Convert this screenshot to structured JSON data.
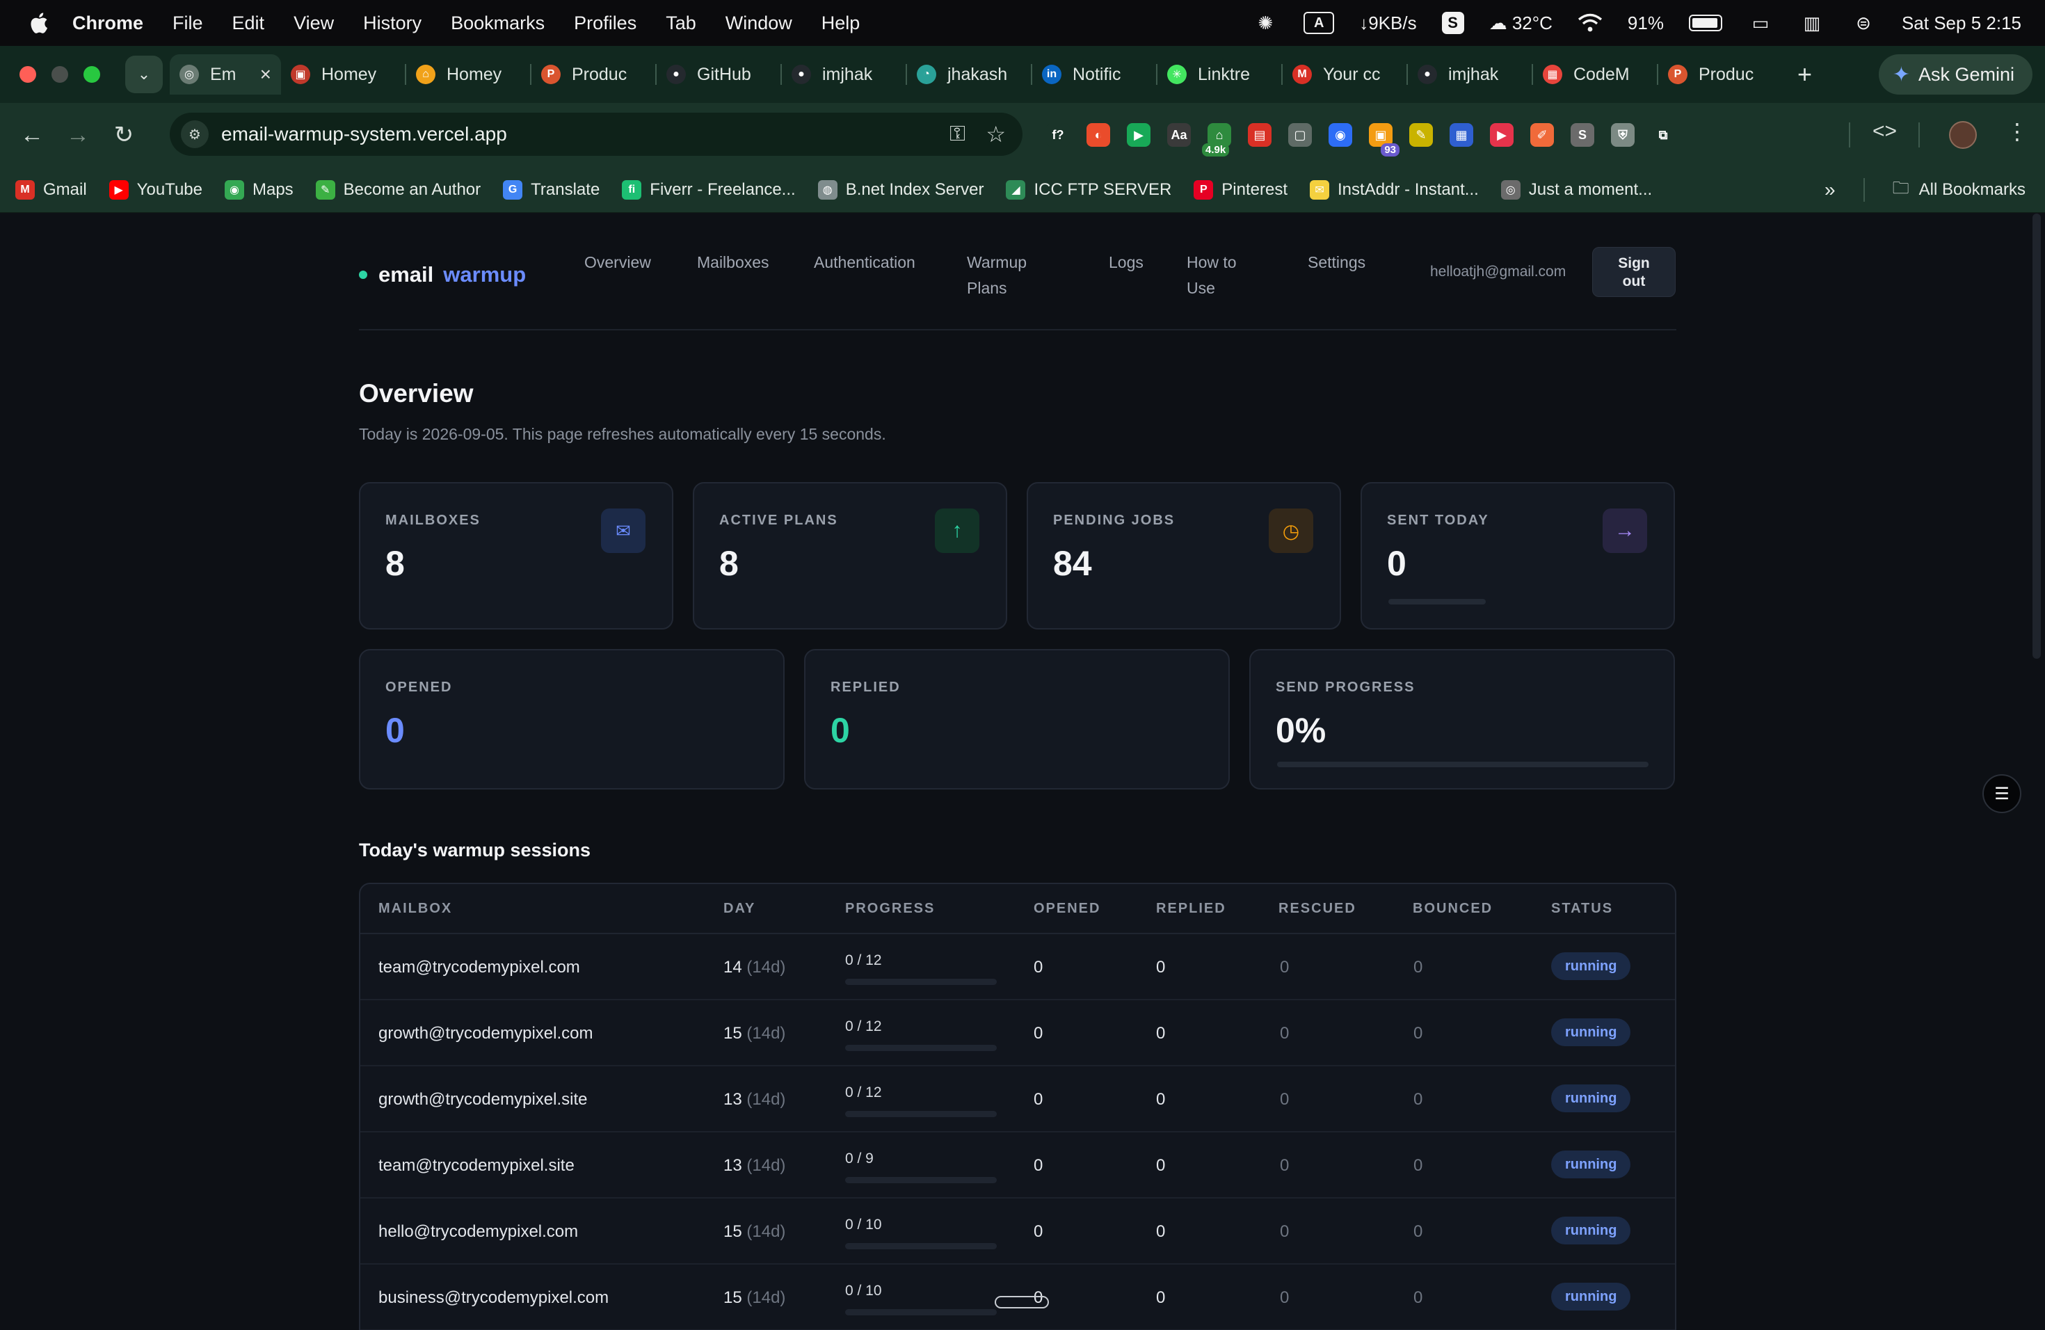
{
  "menubar": {
    "app": "Chrome",
    "items": [
      "File",
      "Edit",
      "View",
      "History",
      "Bookmarks",
      "Profiles",
      "Tab",
      "Window",
      "Help"
    ],
    "net_speed": "↓9KB/s",
    "weather": "32°C",
    "battery": "91%",
    "datetime": "Sat Sep 5  2:15"
  },
  "tabs": [
    {
      "label": "Em",
      "color": "#6b7c74",
      "glyph": "◎",
      "active": true
    },
    {
      "label": "Homey",
      "color": "#c0392b",
      "glyph": "▣"
    },
    {
      "label": "Homey",
      "color": "#f1a21a",
      "glyph": "⌂"
    },
    {
      "label": "Produc",
      "color": "#da552f",
      "glyph": "P"
    },
    {
      "label": "GitHub",
      "color": "#24292e",
      "glyph": "●"
    },
    {
      "label": "imjhak",
      "color": "#24292e",
      "glyph": "●"
    },
    {
      "label": "jhakash",
      "color": "#2aa198",
      "glyph": "◔"
    },
    {
      "label": "Notific",
      "color": "#0a66c2",
      "glyph": "in"
    },
    {
      "label": "Linktre",
      "color": "#43e660",
      "glyph": "✳"
    },
    {
      "label": "Your cc",
      "color": "#d93025",
      "glyph": "M"
    },
    {
      "label": "imjhak",
      "color": "#24292e",
      "glyph": "●"
    },
    {
      "label": "CodeM",
      "color": "#e8453c",
      "glyph": "▦"
    },
    {
      "label": "Produc",
      "color": "#da552f",
      "glyph": "P"
    }
  ],
  "gemini_label": "Ask Gemini",
  "address": "email-warmup-system.vercel.app",
  "extensions": [
    {
      "glyph": "f?",
      "color": "#1a3429",
      "badge": ""
    },
    {
      "glyph": "◐",
      "color": "#ea4c2b",
      "badge": ""
    },
    {
      "glyph": "▶",
      "color": "#18a957",
      "badge": ""
    },
    {
      "glyph": "Aa",
      "color": "#3a3a3a",
      "badge": ""
    },
    {
      "glyph": "⌂",
      "color": "#2e8b3e",
      "badge": "4.9k"
    },
    {
      "glyph": "▤",
      "color": "#d93025",
      "badge": ""
    },
    {
      "glyph": "▢",
      "color": "#5f6b66",
      "badge": ""
    },
    {
      "glyph": "◉",
      "color": "#2d6df6",
      "badge": ""
    },
    {
      "glyph": "▣",
      "color": "#f39c12",
      "badge": "93"
    },
    {
      "glyph": "✎",
      "color": "#c9b300",
      "badge": ""
    },
    {
      "glyph": "▦",
      "color": "#2f5fd0",
      "badge": ""
    },
    {
      "glyph": "▶",
      "color": "#e5334b",
      "badge": ""
    },
    {
      "glyph": "✐",
      "color": "#f06a3a",
      "badge": ""
    },
    {
      "glyph": "S",
      "color": "#6b6b6b",
      "badge": ""
    },
    {
      "glyph": "⛨",
      "color": "#7c8a84",
      "badge": ""
    },
    {
      "glyph": "⧉",
      "color": "#1a3429",
      "badge": ""
    }
  ],
  "bookmarks": [
    {
      "label": "Gmail",
      "color": "#d93025",
      "glyph": "M"
    },
    {
      "label": "YouTube",
      "color": "#ff0000",
      "glyph": "▶"
    },
    {
      "label": "Maps",
      "color": "#34a853",
      "glyph": "◉"
    },
    {
      "label": "Become an Author",
      "color": "#3cb043",
      "glyph": "✎"
    },
    {
      "label": "Translate",
      "color": "#4285f4",
      "glyph": "G"
    },
    {
      "label": "Fiverr - Freelance...",
      "color": "#1dbf73",
      "glyph": "fi"
    },
    {
      "label": "B.net Index Server",
      "color": "#7f8c8d",
      "glyph": "◍"
    },
    {
      "label": "ICC FTP SERVER",
      "color": "#2e8b57",
      "glyph": "◢"
    },
    {
      "label": "Pinterest",
      "color": "#e60023",
      "glyph": "P"
    },
    {
      "label": "InstAddr - Instant...",
      "color": "#f4d03f",
      "glyph": "✉"
    },
    {
      "label": "Just a moment...",
      "color": "#6b6b6b",
      "glyph": "◎"
    }
  ],
  "all_bookmarks": "All Bookmarks",
  "app": {
    "brand_word1": "email",
    "brand_word2": "warmup",
    "nav": [
      {
        "line1": "Overview",
        "line2": ""
      },
      {
        "line1": "Mailboxes",
        "line2": ""
      },
      {
        "line1": "Authentication",
        "line2": ""
      },
      {
        "line1": "Warmup",
        "line2": "Plans"
      },
      {
        "line1": "Logs",
        "line2": ""
      },
      {
        "line1": "How to",
        "line2": "Use"
      },
      {
        "line1": "Settings",
        "line2": ""
      }
    ],
    "user_email": "helloatjh@gmail.com",
    "signout_line1": "Sign",
    "signout_line2": "out",
    "title": "Overview",
    "subtitle": "Today is 2026-09-05. This page refreshes automatically every 15 seconds.",
    "stats": [
      {
        "label": "MAILBOXES",
        "value": "8",
        "icon": "mail-icon",
        "glyph": "✉",
        "accent": "#6b8cff"
      },
      {
        "label": "ACTIVE PLANS",
        "value": "8",
        "icon": "arrow-up-icon",
        "glyph": "↑",
        "accent": "#2dd4a4"
      },
      {
        "label": "PENDING JOBS",
        "value": "84",
        "icon": "clock-icon",
        "glyph": "◷",
        "accent": "#f59e0b"
      },
      {
        "label": "SENT TODAY",
        "value": "0",
        "icon": "arrow-right-icon",
        "glyph": "→",
        "accent": "#a78bfa",
        "progress": 0
      }
    ],
    "stats2": [
      {
        "label": "OPENED",
        "value": "0",
        "color": "#6b8cff"
      },
      {
        "label": "REPLIED",
        "value": "0",
        "color": "#2dd4a4"
      },
      {
        "label": "SEND PROGRESS",
        "value": "0%",
        "color": "#f3f4f6",
        "progress": 0
      }
    ],
    "sessions_title": "Today's warmup sessions",
    "columns": [
      "MAILBOX",
      "DAY",
      "PROGRESS",
      "OPENED",
      "REPLIED",
      "RESCUED",
      "BOUNCED",
      "STATUS"
    ],
    "rows": [
      {
        "mailbox": "team@trycodemypixel.com",
        "day": "14",
        "of": "(14d)",
        "progress": "0 / 12",
        "pct": 0,
        "opened": "0",
        "replied": "0",
        "rescued": "0",
        "bounced": "0",
        "status": "running"
      },
      {
        "mailbox": "growth@trycodemypixel.com",
        "day": "15",
        "of": "(14d)",
        "progress": "0 / 12",
        "pct": 0,
        "opened": "0",
        "replied": "0",
        "rescued": "0",
        "bounced": "0",
        "status": "running"
      },
      {
        "mailbox": "growth@trycodemypixel.site",
        "day": "13",
        "of": "(14d)",
        "progress": "0 / 12",
        "pct": 0,
        "opened": "0",
        "replied": "0",
        "rescued": "0",
        "bounced": "0",
        "status": "running"
      },
      {
        "mailbox": "team@trycodemypixel.site",
        "day": "13",
        "of": "(14d)",
        "progress": "0 / 9",
        "pct": 0,
        "opened": "0",
        "replied": "0",
        "rescued": "0",
        "bounced": "0",
        "status": "running"
      },
      {
        "mailbox": "hello@trycodemypixel.com",
        "day": "15",
        "of": "(14d)",
        "progress": "0 / 10",
        "pct": 0,
        "opened": "0",
        "replied": "0",
        "rescued": "0",
        "bounced": "0",
        "status": "running"
      },
      {
        "mailbox": "business@trycodemypixel.com",
        "day": "15",
        "of": "(14d)",
        "progress": "0 / 10",
        "pct": 0,
        "opened": "0",
        "replied": "0",
        "rescued": "0",
        "bounced": "0",
        "status": "running"
      }
    ]
  }
}
